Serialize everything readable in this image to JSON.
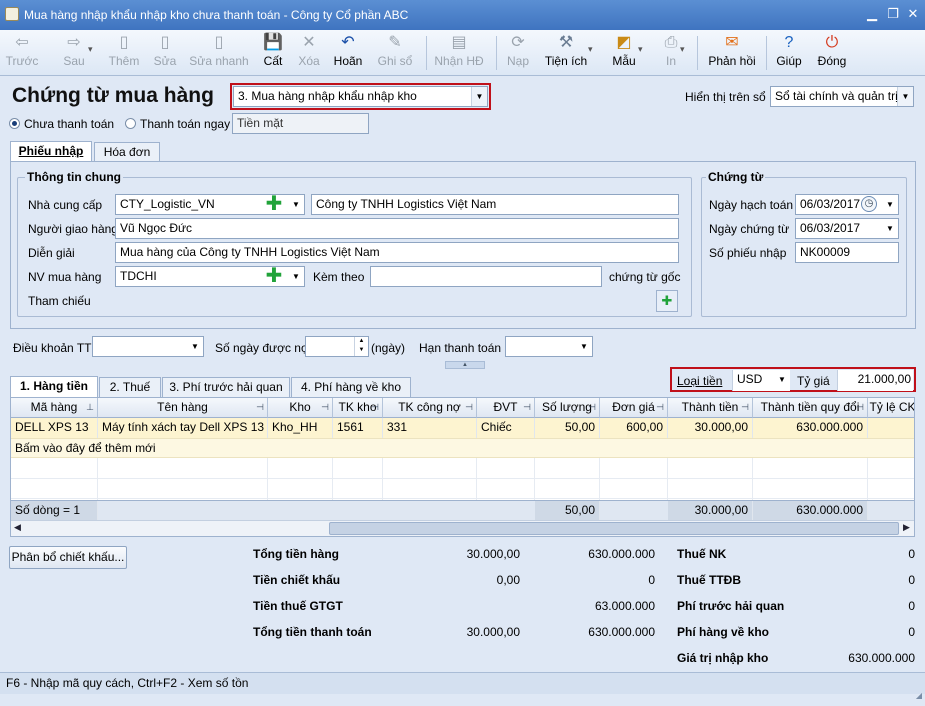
{
  "window": {
    "title": "Mua hàng nhập khẩu nhập kho chưa thanh toán - Công ty Cổ phần ABC"
  },
  "toolbar": {
    "buttons": [
      {
        "label": "Trước",
        "icon": "arrow-left-icon",
        "glyph": "⇦",
        "enabled": false
      },
      {
        "label": "Sau",
        "icon": "arrow-right-icon",
        "glyph": "⇨",
        "enabled": false
      },
      {
        "label": "Thêm",
        "icon": "new-document-icon",
        "glyph": "▯",
        "enabled": false
      },
      {
        "label": "Sửa",
        "icon": "edit-document-icon",
        "glyph": "▯",
        "enabled": false
      },
      {
        "label": "Sửa nhanh",
        "icon": "quick-edit-icon",
        "glyph": "▯",
        "enabled": false
      },
      {
        "label": "Cất",
        "icon": "save-icon",
        "glyph": "💾",
        "enabled": true
      },
      {
        "label": "Xóa",
        "icon": "delete-icon",
        "glyph": "✕",
        "enabled": false
      },
      {
        "label": "Hoãn",
        "icon": "undo-icon",
        "glyph": "↶",
        "enabled": true
      },
      {
        "label": "Ghi sổ",
        "icon": "pencil-icon",
        "glyph": "✎",
        "enabled": false
      },
      {
        "label": "Nhận HĐ",
        "icon": "receive-invoice-icon",
        "glyph": "▤",
        "enabled": false
      },
      {
        "label": "Nạp",
        "icon": "reload-icon",
        "glyph": "⟳",
        "enabled": false
      },
      {
        "label": "Tiện ích",
        "icon": "tools-icon",
        "glyph": "⚒",
        "enabled": true
      },
      {
        "label": "Mẫu",
        "icon": "template-icon",
        "glyph": "◩",
        "enabled": true
      },
      {
        "label": "In",
        "icon": "print-icon",
        "glyph": "⎙",
        "enabled": false
      },
      {
        "label": "Phản hồi",
        "icon": "feedback-mail-icon",
        "glyph": "✉",
        "enabled": true
      },
      {
        "label": "Giúp",
        "icon": "help-icon",
        "glyph": "?",
        "enabled": true
      },
      {
        "label": "Đóng",
        "icon": "close-power-icon",
        "glyph": "⏻",
        "enabled": true
      }
    ]
  },
  "header": {
    "title": "Chứng từ mua hàng",
    "voucher_type": "3. Mua hàng nhập khẩu nhập kho",
    "display_label": "Hiển thị trên sổ",
    "display_value": "Sổ tài chính và quản trị",
    "payment_unpaid": "Chưa thanh toán",
    "payment_now": "Thanh toán ngay",
    "payment_method": "Tiền mặt"
  },
  "tabs": {
    "receipt": "Phiếu nhập",
    "invoice": "Hóa đơn"
  },
  "general": {
    "title": "Thông tin chung",
    "supplier_label": "Nhà cung cấp",
    "supplier_code": "CTY_Logistic_VN",
    "supplier_name": "Công ty TNHH Logistics Việt Nam",
    "deliverer_label": "Người giao hàng",
    "deliverer": "Vũ Ngọc Đức",
    "description_label": "Diễn giải",
    "description": "Mua hàng của Công ty TNHH Logistics Việt Nam",
    "buyer_label": "NV mua hàng",
    "buyer": "TDCHI",
    "attach_label": "Kèm theo",
    "attach_value": "",
    "attach_suffix": "chứng từ gốc",
    "reference_label": "Tham chiếu"
  },
  "voucher": {
    "title": "Chứng từ",
    "posting_date_label": "Ngày hạch toán",
    "posting_date": "06/03/2017",
    "voucher_date_label": "Ngày chứng từ",
    "voucher_date": "06/03/2017",
    "receipt_no_label": "Số phiếu nhập",
    "receipt_no": "NK00009"
  },
  "terms": {
    "payment_terms_label": "Điều khoản TT",
    "payment_terms": "",
    "credit_days_label": "Số ngày được nợ",
    "credit_days": "",
    "days_unit": "(ngày)",
    "due_date_label": "Hạn thanh toán",
    "due_date": ""
  },
  "detail_tabs": [
    "1. Hàng tiền",
    "2. Thuế",
    "3. Phí trước hải quan",
    "4. Phí hàng về kho"
  ],
  "currency": {
    "label": "Loại tiền",
    "value": "USD",
    "rate_label": "Tỷ giá",
    "rate": "21.000,00"
  },
  "grid": {
    "columns": [
      "Mã hàng",
      "Tên hàng",
      "Kho",
      "TK kho",
      "TK công nợ",
      "ĐVT",
      "Số lượng",
      "Đơn giá",
      "Thành tiền",
      "Thành tiền quy đổi",
      "Tỷ lệ CK"
    ],
    "rows": [
      [
        "DELL XPS 13",
        "Máy tính xách tay Dell XPS 13",
        "Kho_HH",
        "1561",
        "331",
        "Chiếc",
        "50,00",
        "600,00",
        "30.000,00",
        "630.000.000",
        ""
      ]
    ],
    "new_row_hint": "Bấm vào đây để thêm mới",
    "footer_count": "Số dòng = 1",
    "footer_qty": "50,00",
    "footer_amount": "30.000,00",
    "footer_converted": "630.000.000"
  },
  "discount_button": "Phân bổ chiết khấu...",
  "totals": {
    "goods_label": "Tổng tiền hàng",
    "goods_fc": "30.000,00",
    "goods_vnd": "630.000.000",
    "discount_label": "Tiền chiết khấu",
    "discount_fc": "0,00",
    "discount_vnd": "0",
    "vat_label": "Tiền thuế GTGT",
    "vat_vnd": "63.000.000",
    "total_label": "Tổng tiền thanh toán",
    "total_fc": "30.000,00",
    "total_vnd": "630.000.000",
    "import_tax_label": "Thuế NK",
    "import_tax": "0",
    "excise_label": "Thuế TTĐB",
    "excise": "0",
    "pre_customs_label": "Phí trước hải quan",
    "pre_customs": "0",
    "to_warehouse_label": "Phí hàng về kho",
    "to_warehouse": "0",
    "import_value_label": "Giá trị nhập kho",
    "import_value": "630.000.000"
  },
  "statusbar": {
    "text": "F6 - Nhập mã quy cách, Ctrl+F2 - Xem số tồn"
  }
}
